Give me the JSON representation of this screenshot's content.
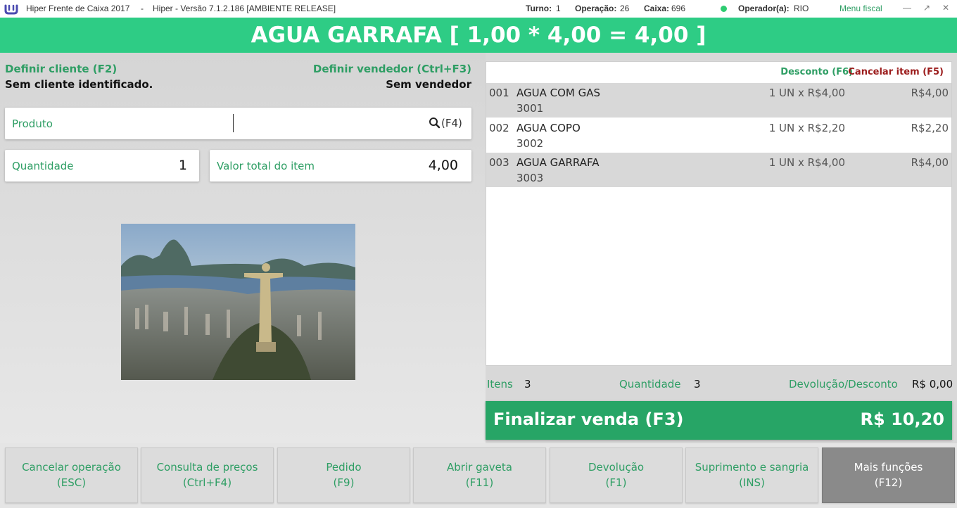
{
  "titlebar": {
    "app_title": "Hiper Frente de Caixa 2017",
    "separator": "-",
    "version": "Hiper - Versão 7.1.2.186 [AMBIENTE RELEASE]",
    "turno_label": "Turno:",
    "turno_value": "1",
    "operacao_label": "Operação:",
    "operacao_value": "26",
    "caixa_label": "Caixa:",
    "caixa_value": "696",
    "operador_label": "Operador(a):",
    "operador_value": "RIO",
    "menu_fiscal": "Menu fiscal",
    "status_color": "#2ecc71"
  },
  "header": {
    "current_item": "AGUA GARRAFA [ 1,00 * 4,00 = 4,00 ]"
  },
  "cliente": {
    "link": "Definir cliente (F2)",
    "status": "Sem cliente identificado."
  },
  "vendedor": {
    "link": "Definir vendedor (Ctrl+F3)",
    "status": "Sem vendedor"
  },
  "produto": {
    "label": "Produto",
    "value": "",
    "search_shortcut": "(F4)",
    "search_icon": "search-icon"
  },
  "quantidade": {
    "label": "Quantidade",
    "value": "1"
  },
  "valor_total_item": {
    "label": "Valor total do item",
    "value": "4,00"
  },
  "list": {
    "desconto_link": "Desconto (F6)",
    "cancelar_link": "Cancelar item (F5)",
    "items": [
      {
        "num": "001",
        "desc": "AGUA COM GAS",
        "code": "3001",
        "qty": "1 UN x R$4,00",
        "price": "R$4,00"
      },
      {
        "num": "002",
        "desc": "AGUA COPO",
        "code": "3002",
        "qty": "1 UN x R$2,20",
        "price": "R$2,20"
      },
      {
        "num": "003",
        "desc": "AGUA GARRAFA",
        "code": "3003",
        "qty": "1 UN x R$4,00",
        "price": "R$4,00"
      }
    ]
  },
  "summary": {
    "itens_label": "Itens",
    "itens_value": "3",
    "quantidade_label": "Quantidade",
    "quantidade_value": "3",
    "devolucao_label": "Devolução/Desconto",
    "devolucao_value": "R$ 0,00"
  },
  "finalizar": {
    "label": "Finalizar venda (F3)",
    "total": "R$ 10,20"
  },
  "function_buttons": [
    {
      "l1": "Cancelar operação",
      "l2": "(ESC)"
    },
    {
      "l1": "Consulta de preços",
      "l2": "(Ctrl+F4)"
    },
    {
      "l1": "Pedido",
      "l2": "(F9)"
    },
    {
      "l1": "Abrir gaveta",
      "l2": "(F11)"
    },
    {
      "l1": "Devolução",
      "l2": "(F1)"
    },
    {
      "l1": "Suprimento e sangria",
      "l2": "(INS)"
    },
    {
      "l1": "Mais funções",
      "l2": "(F12)"
    }
  ],
  "colors": {
    "brand_green": "#2ecc85",
    "finalizar_green": "#27a566",
    "link_green": "#2e9e64",
    "cancel_red": "#9b1b1b"
  }
}
